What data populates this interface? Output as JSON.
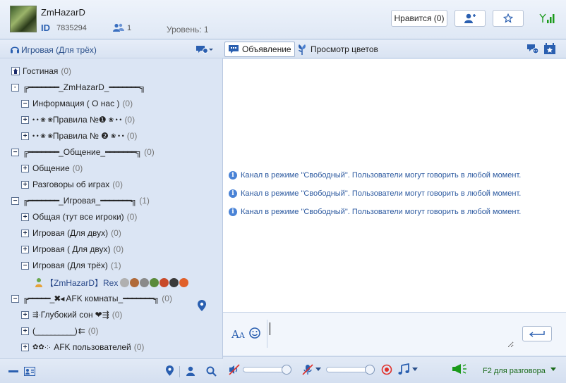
{
  "header": {
    "username": "ZmHazarD",
    "id_label": "ID",
    "id_value": "7835294",
    "members_count": "1",
    "level": "Уровень: 1",
    "like_button": "Нравится (0)"
  },
  "left": {
    "room_title": "Игровая (Для трёх)",
    "tree": [
      {
        "label": "Гостиная",
        "count": "(0)"
      },
      {
        "label": "_ZmHazarD_",
        "count": ""
      },
      {
        "label": "Информация ( О нас )",
        "count": "(0)"
      },
      {
        "label": "Правила №❶",
        "count": "(0)"
      },
      {
        "label": "Правила № ❷",
        "count": "(0)"
      },
      {
        "label": "_Общение_",
        "count": "(0)"
      },
      {
        "label": "Общение",
        "count": "(0)"
      },
      {
        "label": "Разговоры об играх",
        "count": "(0)"
      },
      {
        "label": "_Игровая_",
        "count": "(1)"
      },
      {
        "label": "Общая (тут все игроки)",
        "count": "(0)"
      },
      {
        "label": "Игровая (Для двух)",
        "count": "(0)"
      },
      {
        "label": "Игровая ( Для двух)",
        "count": "(0)"
      },
      {
        "label": "Игровая (Для трёх)",
        "count": "(1)"
      },
      {
        "label": "【ZmHazarD】Rex",
        "count": ""
      },
      {
        "label": "AFK комнаты_",
        "count": "(0)"
      },
      {
        "label": "Глубокий сон",
        "count": "(0)"
      },
      {
        "label": "(__________)",
        "count": "(0)"
      },
      {
        "label": "AFK пользователей",
        "count": "(0)"
      }
    ]
  },
  "right": {
    "tab_announcement": "Объявление",
    "tab_flowers": "Просмотр цветов",
    "messages": [
      "Канал в режиме \"Свободный\". Пользователи могут говорить в любой момент.",
      "Канал в режиме \"Свободный\". Пользователи могут говорить в любой момент.",
      "Канал в режиме \"Свободный\". Пользователи могут говорить в любой момент."
    ],
    "f2_label": "F2 для разговора",
    "mic_volume": 0.95,
    "speaker_volume": 0.95
  },
  "colors": {
    "accent": "#2a5fb0",
    "message_text": "#2d5aa0",
    "status_green": "#1a9a1a",
    "record_red": "#e0302a"
  }
}
